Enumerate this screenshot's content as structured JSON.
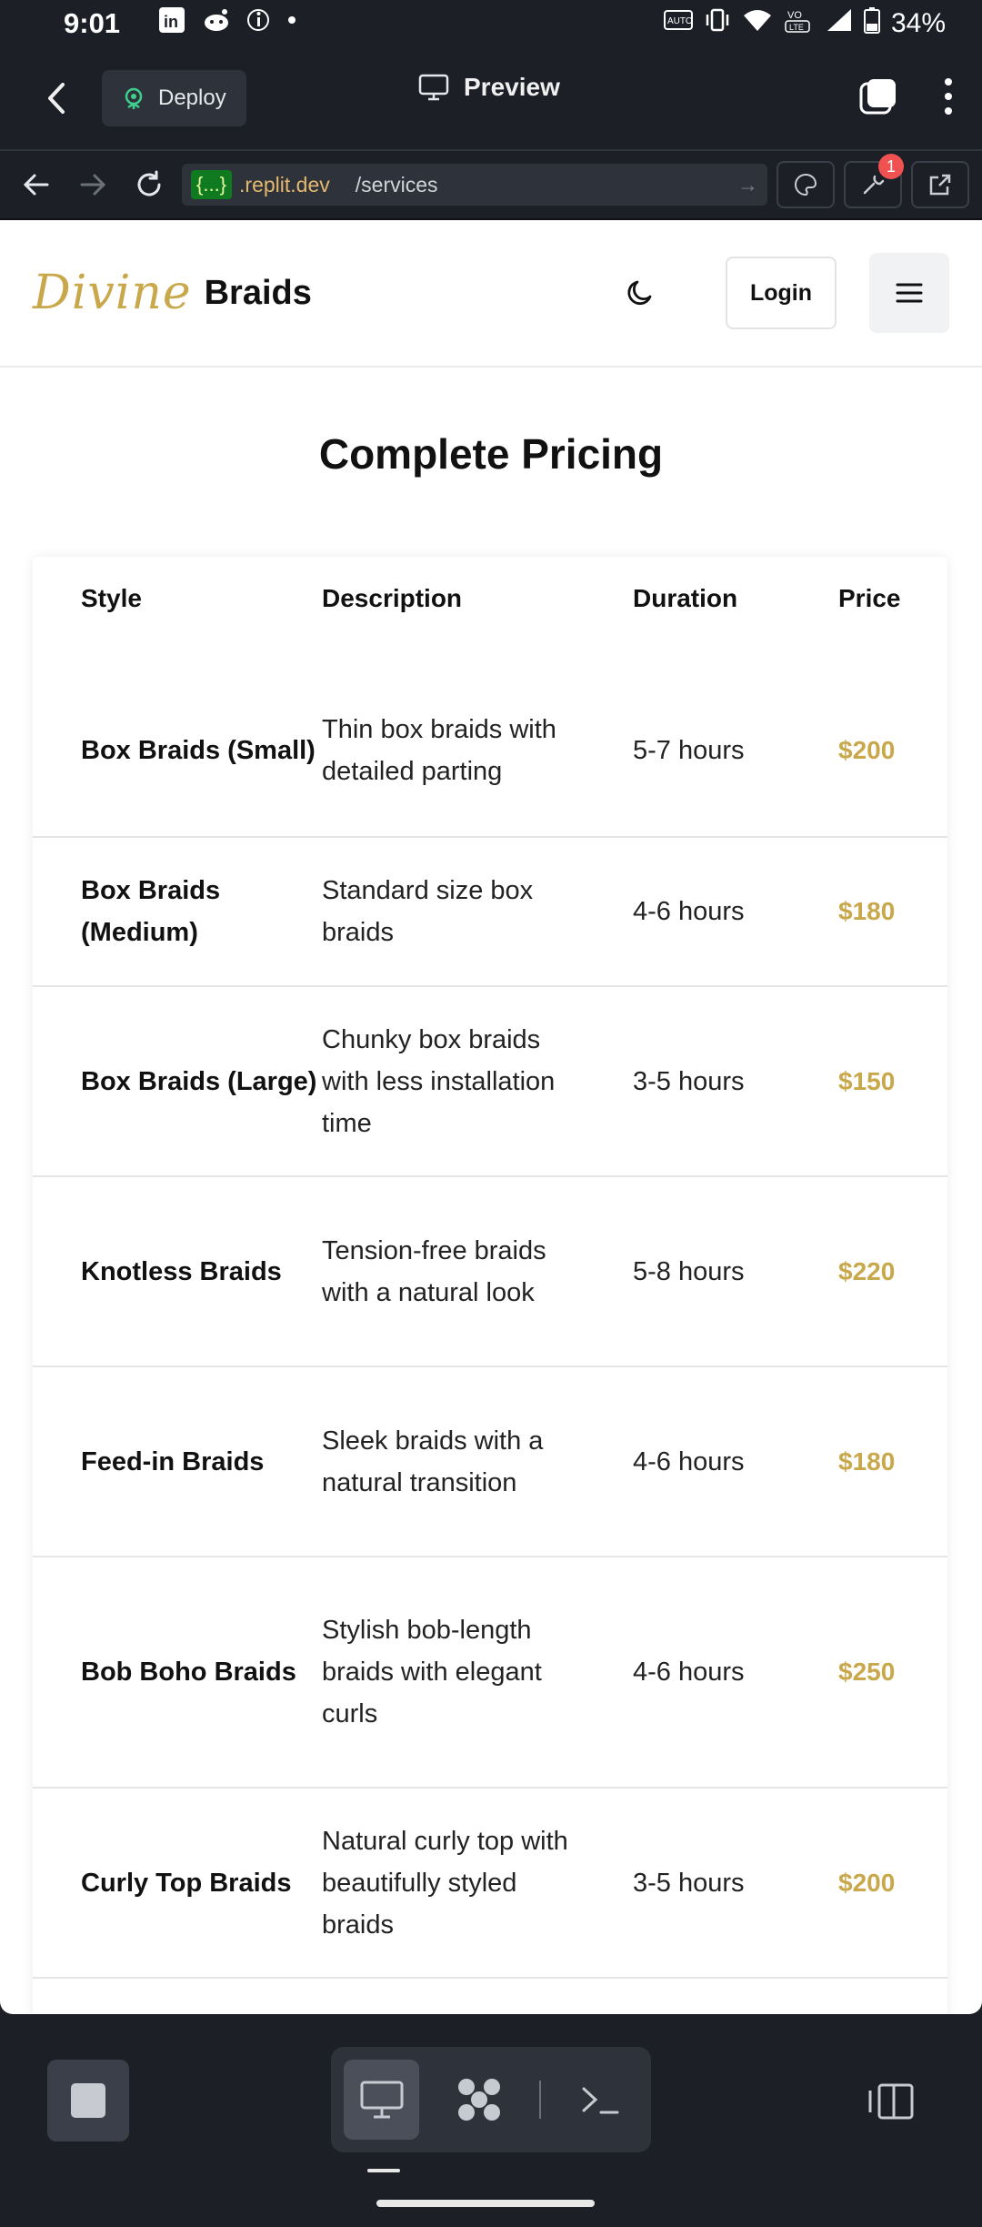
{
  "status_bar": {
    "time": "9:01",
    "battery": "34%",
    "left_icons": [
      "linkedin-icon",
      "reddit-icon",
      "info-icon",
      "dot-icon"
    ],
    "right_icons": [
      "auto-icon",
      "vibrate-icon",
      "wifi-icon",
      "volte-icon",
      "signal-icon",
      "battery-icon"
    ]
  },
  "replit_bar": {
    "deploy_label": "Deploy",
    "preview_label": "Preview"
  },
  "url_bar": {
    "tag": "{...}",
    "host": ".replit.dev",
    "path": "/services",
    "badge_count": "1"
  },
  "site": {
    "logo_script": "Divine",
    "logo_word": "Braids",
    "login_label": "Login",
    "title": "Complete Pricing",
    "accent_color": "#c9a84c"
  },
  "pricing": {
    "headers": {
      "style": "Style",
      "description": "Description",
      "duration": "Duration",
      "price": "Price"
    },
    "rows": [
      {
        "style": "Box Braids (Small)",
        "description": "Thin box braids with detailed parting",
        "duration": "5-7 hours",
        "price": "$200"
      },
      {
        "style": "Box Braids (Medium)",
        "description": "Standard size box braids",
        "duration": "4-6 hours",
        "price": "$180"
      },
      {
        "style": "Box Braids (Large)",
        "description": "Chunky box braids with less installation time",
        "duration": "3-5 hours",
        "price": "$150"
      },
      {
        "style": "Knotless Braids",
        "description": "Tension-free braids with a natural look",
        "duration": "5-8 hours",
        "price": "$220"
      },
      {
        "style": "Feed-in Braids",
        "description": "Sleek braids with a natural transition",
        "duration": "4-6 hours",
        "price": "$180"
      },
      {
        "style": "Bob Boho Braids",
        "description": "Stylish bob-length braids with elegant curls",
        "duration": "4-6 hours",
        "price": "$250"
      },
      {
        "style": "Curly Top Braids",
        "description": "Natural curly top with beautifully styled braids",
        "duration": "3-5 hours",
        "price": "$200"
      }
    ]
  }
}
